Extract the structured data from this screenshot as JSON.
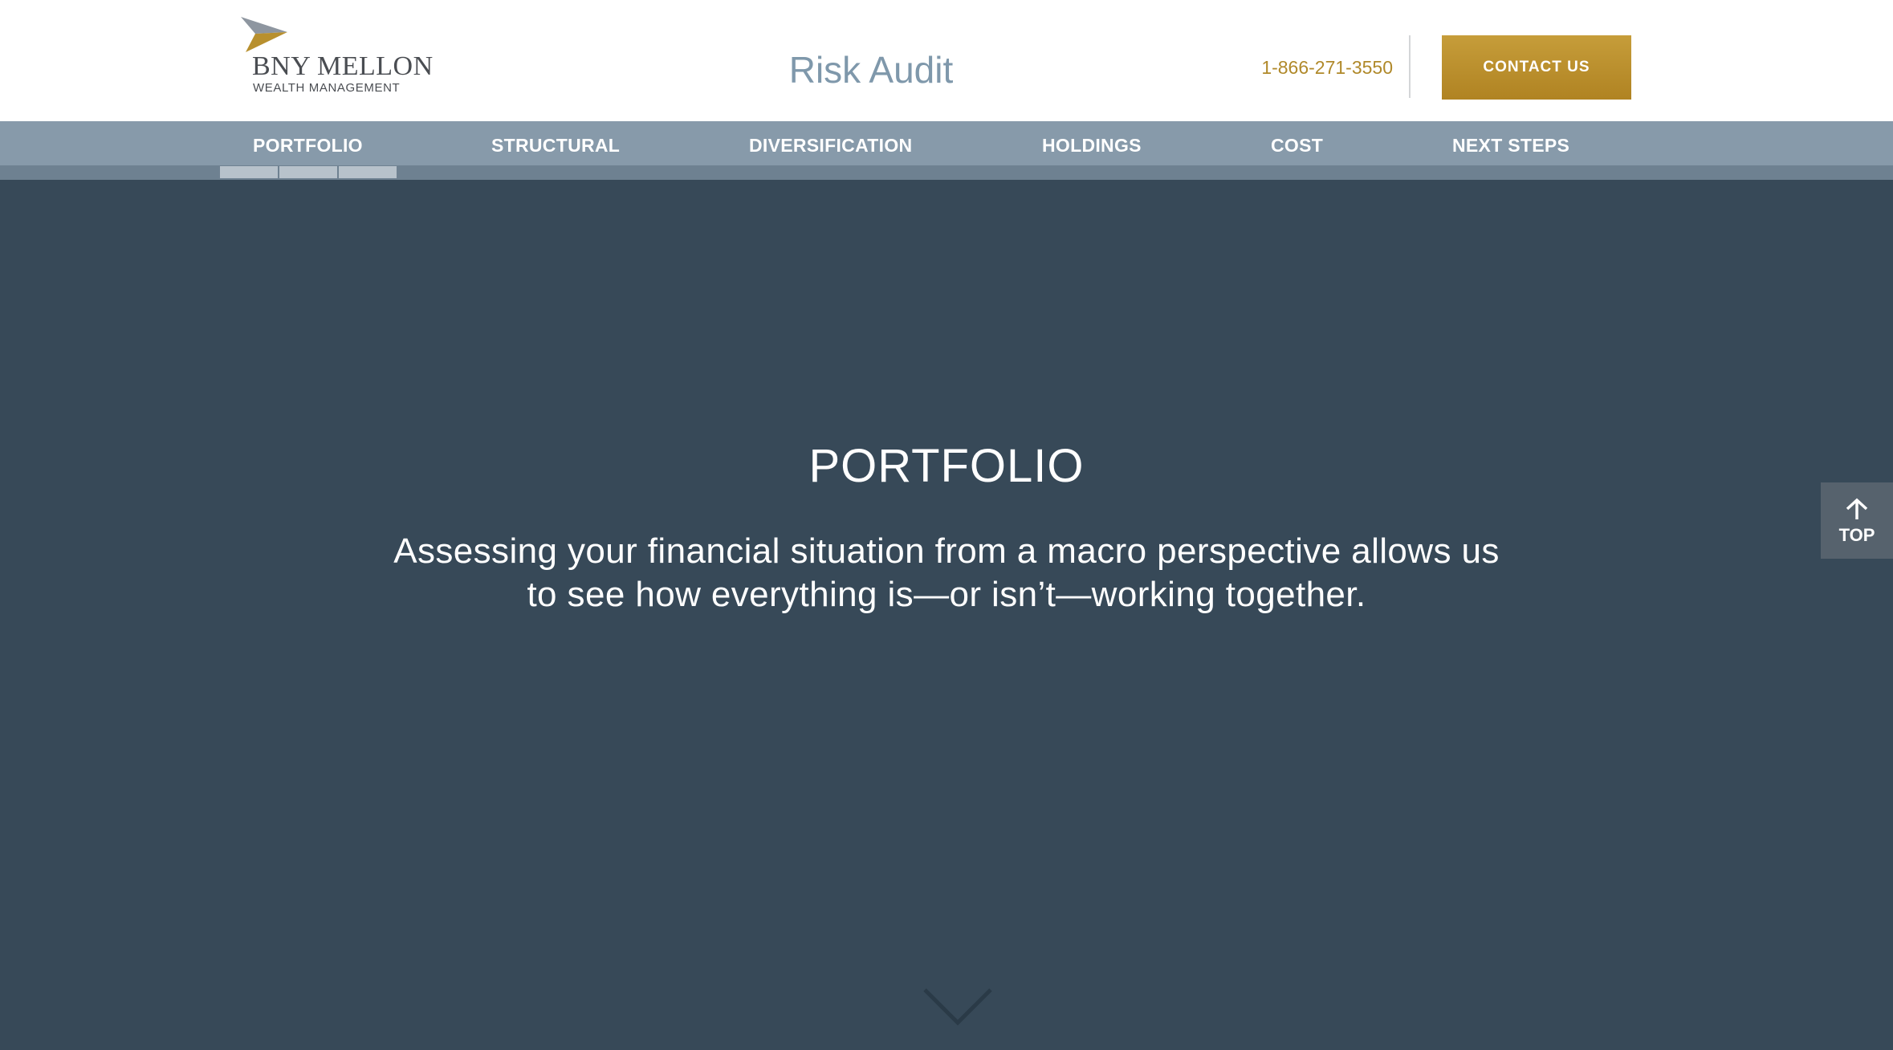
{
  "header": {
    "logo_name": "BNY MELLON",
    "logo_sub": "WEALTH MANAGEMENT",
    "title": "Risk Audit",
    "phone": "1-866-271-3550",
    "contact_label": "CONTACT US"
  },
  "nav": {
    "items": [
      {
        "label": "PORTFOLIO",
        "active": true
      },
      {
        "label": "STRUCTURAL",
        "active": false
      },
      {
        "label": "DIVERSIFICATION",
        "active": false
      },
      {
        "label": "HOLDINGS",
        "active": false
      },
      {
        "label": "COST",
        "active": false
      },
      {
        "label": "NEXT STEPS",
        "active": false
      }
    ],
    "progress_segments_filled": 3
  },
  "hero": {
    "title": "PORTFOLIO",
    "description": "Assessing your financial situation from a macro perspective allows us to see how everything is—or isn’t—working together."
  },
  "back_to_top": {
    "label": "TOP",
    "icon": "arrow-up-icon"
  },
  "scroll_indicator": {
    "icon": "chevron-down-icon"
  },
  "colors": {
    "brand_gold": "#b8902e",
    "nav_bg": "#879aaa",
    "hero_bg": "#374958",
    "title_blue": "#7f98ab"
  }
}
